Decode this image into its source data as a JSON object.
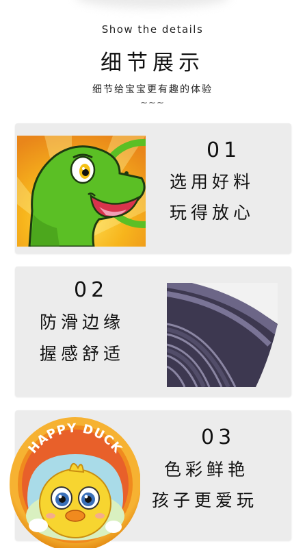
{
  "header": {
    "subtitle_en": "Show the details",
    "title_cn": "细节展示",
    "tagline": "细节给宝宝更有趣的体验",
    "decoration": "~~~"
  },
  "features": [
    {
      "number": "01",
      "line1": "选用好料",
      "line2": "玩得放心",
      "image": "dinosaur-cartoon"
    },
    {
      "number": "02",
      "line1": "防滑边缘",
      "line2": "握感舒适",
      "image": "rim-closeup"
    },
    {
      "number": "03",
      "line1": "色彩鲜艳",
      "line2": "孩子更爱玩",
      "image": "happy-duck-frisbee"
    }
  ],
  "duck_frisbee": {
    "text": "HAPPY DUCK"
  },
  "colors": {
    "card_bg": "#ececec",
    "dino_green": "#5bbf25",
    "rim_purple": "#4a4560",
    "frisbee_orange": "#f3a324",
    "duck_yellow": "#f7d530"
  }
}
